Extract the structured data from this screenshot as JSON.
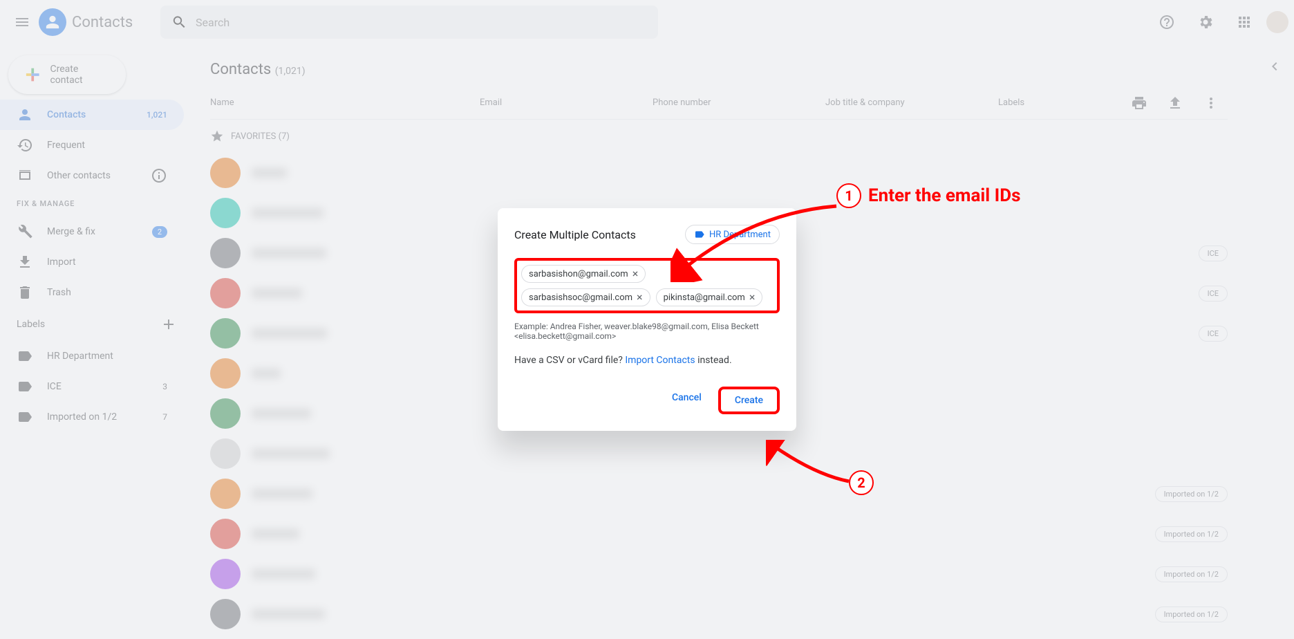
{
  "app": {
    "name": "Contacts"
  },
  "search": {
    "placeholder": "Search"
  },
  "sidebar": {
    "create_label": "Create contact",
    "items": [
      {
        "label": "Contacts",
        "count": "1,021"
      },
      {
        "label": "Frequent"
      },
      {
        "label": "Other contacts"
      }
    ],
    "section_fix": "FIX & MANAGE",
    "fix_items": [
      {
        "label": "Merge & fix",
        "badge": "2"
      },
      {
        "label": "Import"
      },
      {
        "label": "Trash"
      }
    ],
    "labels_header": "Labels",
    "labels": [
      {
        "label": "HR Department",
        "count": ""
      },
      {
        "label": "ICE",
        "count": "3"
      },
      {
        "label": "Imported on 1/2",
        "count": "7"
      }
    ]
  },
  "main": {
    "title": "Contacts",
    "count": "(1,021)",
    "columns": {
      "name": "Name",
      "email": "Email",
      "phone": "Phone number",
      "job": "Job title & company",
      "labels": "Labels"
    },
    "favorites_label": "FAVORITES (7)",
    "rows": [
      {
        "avatar": "#e8710a",
        "chips": []
      },
      {
        "avatar": "#00bfa5",
        "chips": []
      },
      {
        "avatar": "#5f6368",
        "chips": [
          "ICE"
        ]
      },
      {
        "avatar": "#d93025",
        "chips": [
          "ICE"
        ]
      },
      {
        "avatar": "#188038",
        "chips": [
          "ICE"
        ]
      },
      {
        "avatar": "#e8710a",
        "chips": []
      },
      {
        "avatar": "#188038",
        "chips": []
      },
      {
        "avatar": "#cccccc",
        "chips": []
      },
      {
        "avatar": "#e8710a",
        "chips": [
          "Imported on 1/2"
        ]
      },
      {
        "avatar": "#d93025",
        "chips": [
          "Imported on 1/2"
        ]
      },
      {
        "avatar": "#9334e6",
        "chips": [
          "Imported on 1/2"
        ]
      },
      {
        "avatar": "#5f6368",
        "chips": [
          "Imported on 1/2"
        ]
      }
    ]
  },
  "dialog": {
    "title": "Create Multiple Contacts",
    "label_chip": "HR Department",
    "emails": [
      "sarbasishon@gmail.com",
      "sarbasishsoc@gmail.com",
      "pikinsta@gmail.com"
    ],
    "example": "Example: Andrea Fisher, weaver.blake98@gmail.com, Elisa Beckett <elisa.beckett@gmail.com>",
    "import_prefix": "Have a CSV or vCard file? ",
    "import_link": "Import Contacts",
    "import_suffix": " instead.",
    "cancel": "Cancel",
    "create": "Create"
  },
  "annotations": {
    "step1": "1",
    "step1_text": "Enter the email IDs",
    "step2": "2"
  }
}
